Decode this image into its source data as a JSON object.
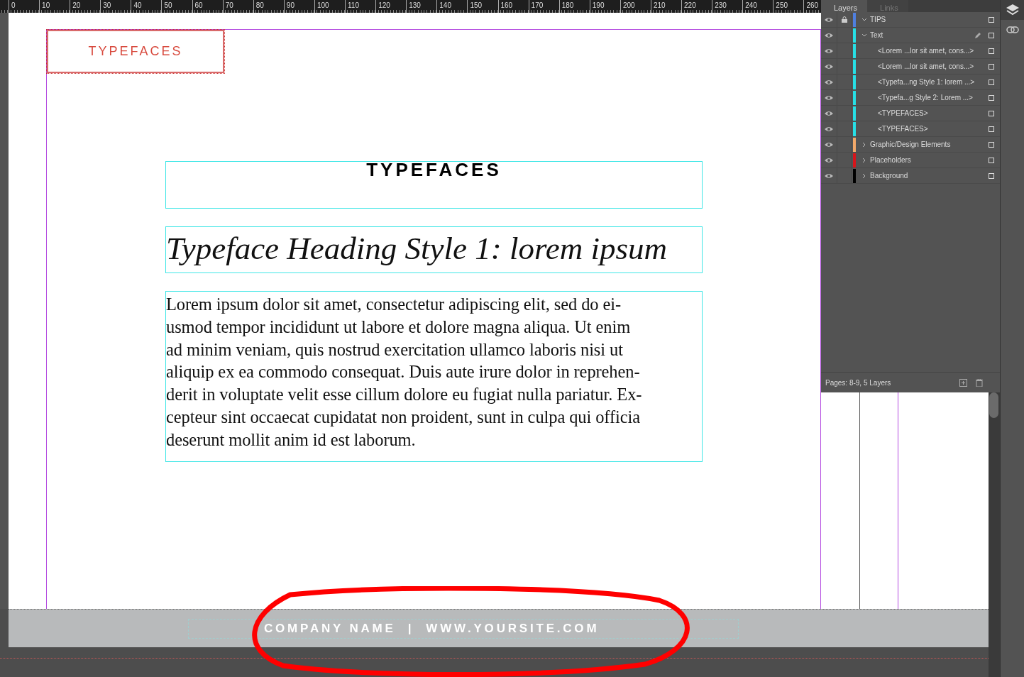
{
  "ruler": {
    "labels": [
      "0",
      "10",
      "20",
      "30",
      "40",
      "50",
      "60",
      "70",
      "80",
      "90",
      "100",
      "110",
      "120",
      "130",
      "140",
      "150",
      "160",
      "170",
      "180",
      "190",
      "200",
      "210",
      "220",
      "230",
      "240",
      "250",
      "260"
    ]
  },
  "document": {
    "corner_title": "TYPEFACES",
    "title": "TYPEFACES",
    "heading": "Typeface Heading Style 1: lorem ipsum",
    "body": "Lorem ipsum dolor sit amet, consectetur adipiscing elit, sed do ei-\nusmod tempor incididunt ut labore et dolore magna aliqua. Ut enim\nad minim veniam, quis nostrud exercitation ullamco laboris nisi ut\naliquip ex ea commodo consequat. Duis aute irure dolor in reprehen-\nderit in voluptate velit esse cillum dolore eu fugiat nulla pariatur. Ex-\ncepteur sint occaecat cupidatat non proident, sunt in culpa qui officia\ndeserunt mollit anim id est laborum.",
    "footer": "COMPANY NAME  |  WWW.YOURSITE.COM"
  },
  "panel": {
    "tabs": [
      {
        "label": "Layers",
        "selected": true
      },
      {
        "label": "Links",
        "selected": false
      }
    ],
    "layers": [
      {
        "name": "TIPS",
        "color": "#4f7fe0",
        "locked": true,
        "expanded": true,
        "current": false
      },
      {
        "name": "Text",
        "color": "#27e0e6",
        "locked": false,
        "expanded": true,
        "current": true,
        "children": [
          {
            "name": "<Lorem ...lor sit amet, cons...>"
          },
          {
            "name": "<Lorem ...lor sit amet, cons...>"
          },
          {
            "name": "<Typefa...ng Style 1: lorem ...>"
          },
          {
            "name": "<Typefa...g Style 2: Lorem ...>"
          },
          {
            "name": "<TYPEFACES>"
          },
          {
            "name": "<TYPEFACES>"
          }
        ]
      },
      {
        "name": "Graphic/Design Elements",
        "color": "#f2a96a",
        "locked": false,
        "expanded": false,
        "current": false
      },
      {
        "name": "Placeholders",
        "color": "#d8151b",
        "locked": false,
        "expanded": false,
        "current": false
      },
      {
        "name": "Background",
        "color": "#000000",
        "locked": false,
        "expanded": false,
        "current": false
      }
    ],
    "status": "Pages: 8-9, 5 Layers"
  }
}
